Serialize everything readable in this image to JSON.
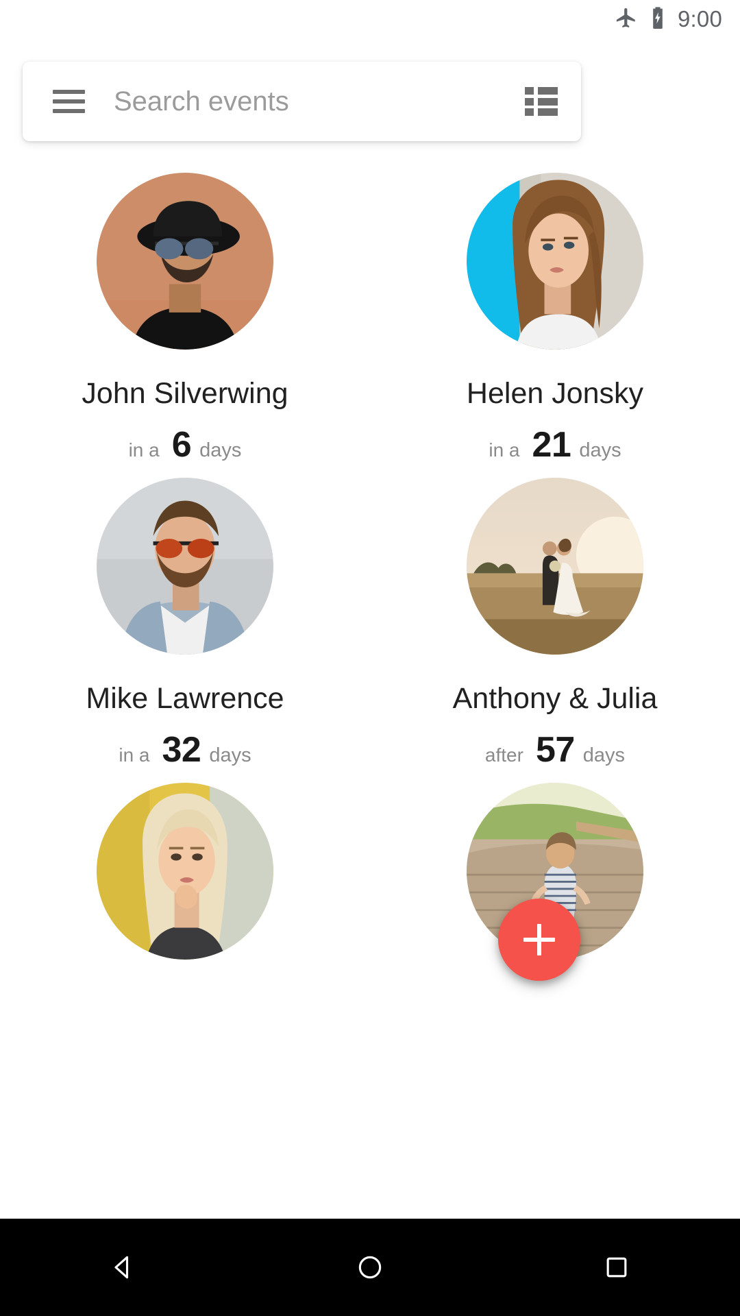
{
  "status_bar": {
    "airplane_icon": "airplane-mode-icon",
    "battery_icon": "battery-charging-icon",
    "time": "9:00"
  },
  "search": {
    "menu_icon": "hamburger-menu-icon",
    "placeholder": "Search events",
    "view_toggle_icon": "view-list-icon"
  },
  "events": [
    {
      "name": "John Silverwing",
      "prefix": "in a",
      "number": "6",
      "unit": "days",
      "avatar": "portrait-man-hat-sunglasses"
    },
    {
      "name": "Helen Jonsky",
      "prefix": "in a",
      "number": "21",
      "unit": "days",
      "avatar": "portrait-woman-brown-hair"
    },
    {
      "name": "Mike Lawrence",
      "prefix": "in a",
      "number": "32",
      "unit": "days",
      "avatar": "portrait-man-denim-jacket"
    },
    {
      "name": "Anthony & Julia",
      "prefix": "after",
      "number": "57",
      "unit": "days",
      "avatar": "wedding-couple-field"
    },
    {
      "name": "",
      "prefix": "",
      "number": "",
      "unit": "",
      "avatar": "portrait-blonde-woman"
    },
    {
      "name": "",
      "prefix": "",
      "number": "",
      "unit": "",
      "avatar": "child-on-boardwalk"
    }
  ],
  "fab": {
    "label": "+",
    "icon": "plus-icon",
    "color": "#F4524A"
  },
  "navbar": {
    "back": "back-triangle-icon",
    "home": "home-circle-icon",
    "recents": "recents-square-icon"
  },
  "colors": {
    "accent": "#F4524A",
    "text_primary": "#212121",
    "text_secondary": "#8a8a8a",
    "placeholder": "#9b9b9b",
    "status_icon": "#5f6368",
    "navbar_bg": "#000000",
    "page_bg": "#ffffff"
  }
}
